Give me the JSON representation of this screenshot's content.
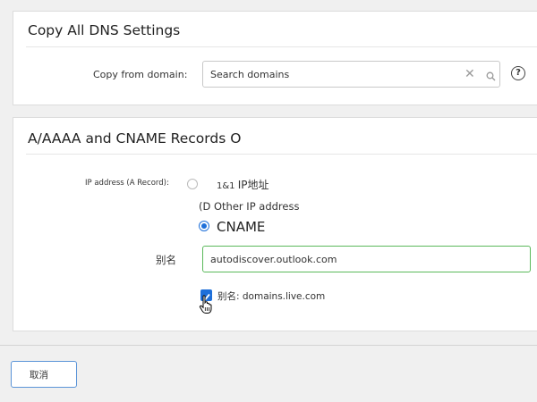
{
  "copy_section": {
    "title": "Copy All DNS Settings",
    "copy_from_label": "Copy from domain:",
    "search_placeholder": "Search domains",
    "clear_symbol": "✕",
    "help_symbol": "?"
  },
  "records_section": {
    "title": "A/AAAA and CNAME Records O",
    "ip_address_label": "IP address (A Record):",
    "option_1and1_prefix": "1&1",
    "option_1and1_suffix": "IP地址",
    "option_other_ip": "(D Other IP address",
    "option_cname": "CNAME",
    "alias_label": "别名",
    "alias_value": "autodiscover.outlook.com",
    "checkbox_label": "别名: domains.live.com",
    "checkbox_checked": true,
    "selected_option": "CNAME"
  },
  "footer": {
    "cancel_label": "取消"
  },
  "colors": {
    "accent": "#1e6fd9",
    "valid_border": "#5bb95b",
    "button_border": "#5b94d8"
  },
  "icons": [
    "search-icon",
    "clear-icon",
    "help-icon",
    "check-icon",
    "hand-cursor-icon"
  ]
}
